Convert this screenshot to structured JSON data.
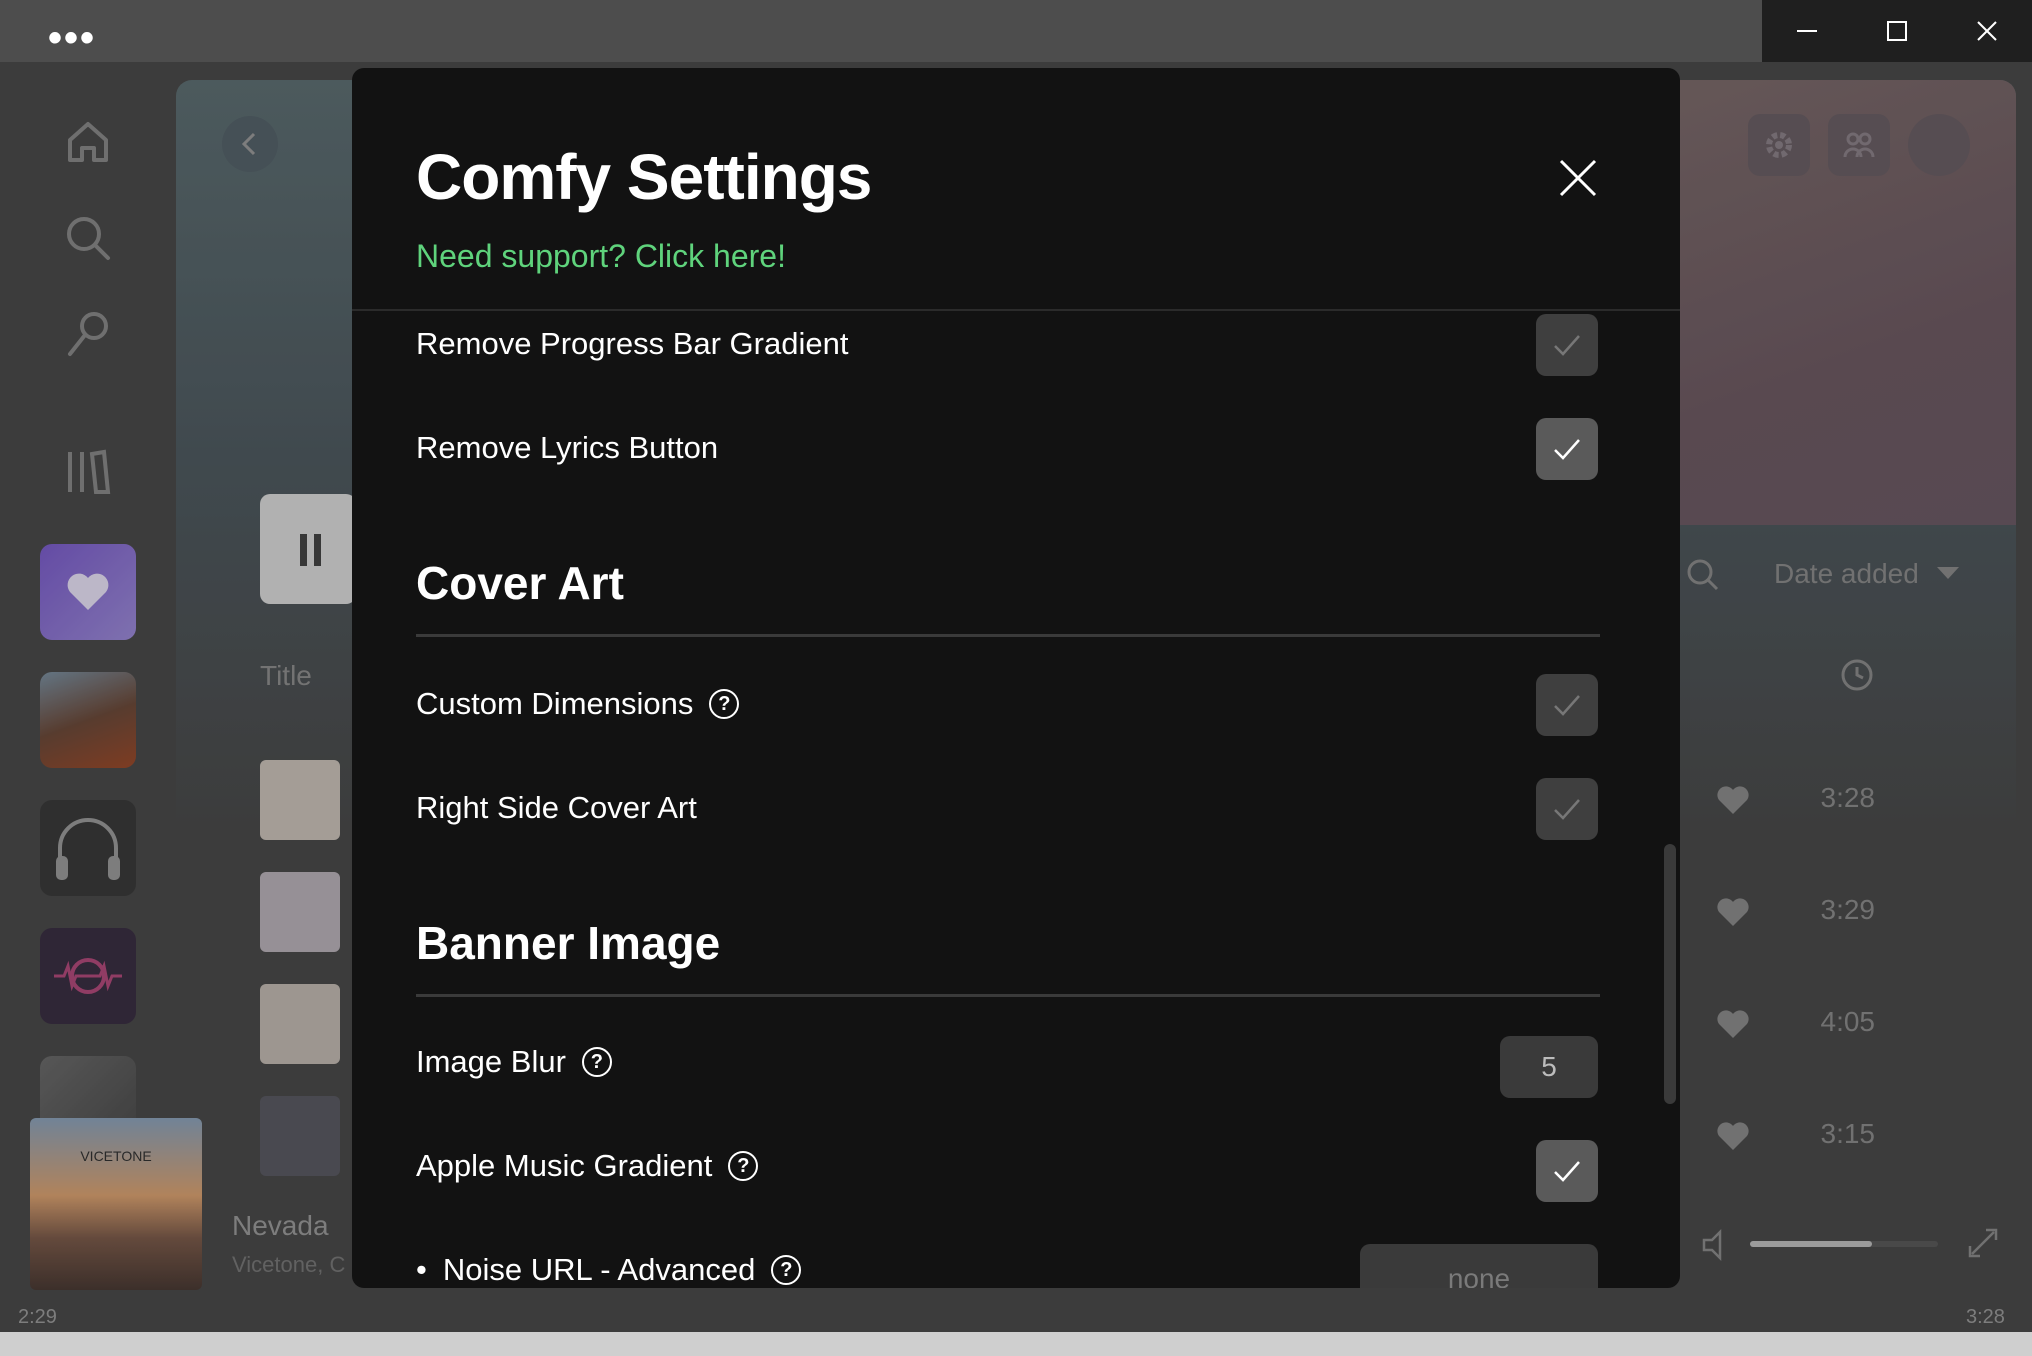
{
  "window": {
    "menu_icon": "more-dots-icon",
    "controls": [
      "minimize-icon",
      "maximize-icon",
      "close-icon"
    ]
  },
  "sidebar": {
    "nav": [
      "home-icon",
      "search-icon",
      "microphone-icon",
      "library-icon"
    ],
    "playlists": [
      "liked-songs",
      "playlist-1",
      "playlist-2",
      "playlist-3",
      "playlist-4"
    ]
  },
  "background": {
    "column_title": "Title",
    "sort_label": "Date added",
    "durations": [
      "3:28",
      "3:29",
      "4:05",
      "3:15"
    ],
    "now_playing": {
      "track": "Nevada",
      "artist": "Vicetone, C",
      "album_label": "VICETONE"
    },
    "elapsed": "2:29",
    "total": "3:28",
    "volume_level": 0.65
  },
  "modal": {
    "title": "Comfy Settings",
    "support_link": "Need support? Click here!",
    "rows": [
      {
        "label": "Remove Progress Bar Gradient",
        "checked": false
      },
      {
        "label": "Remove Lyrics Button",
        "checked": true
      }
    ],
    "sections": [
      {
        "heading": "Cover Art",
        "rows": [
          {
            "label": "Custom Dimensions",
            "help": true,
            "checked": false
          },
          {
            "label": "Right Side Cover Art",
            "help": false,
            "checked": false
          }
        ]
      },
      {
        "heading": "Banner Image",
        "rows": [
          {
            "label": "Image Blur",
            "help": true,
            "value": "5"
          },
          {
            "label": "Apple Music Gradient",
            "help": true,
            "checked": true
          },
          {
            "label": "Noise URL - Advanced",
            "help": true,
            "value": "none",
            "bullet": "•"
          }
        ]
      }
    ],
    "accent": "#5fd37c"
  }
}
